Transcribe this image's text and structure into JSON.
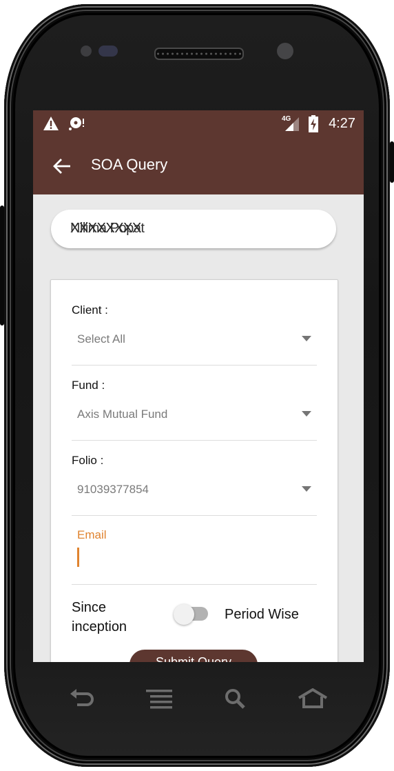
{
  "status_bar": {
    "time": "4:27",
    "network": "4G",
    "left_icons": [
      "warning-icon",
      "sd-card-alert-icon"
    ],
    "right_icons": [
      "signal-icon",
      "battery-charging-icon"
    ]
  },
  "app_bar": {
    "title": "SOA Query",
    "back_icon": "arrow-back-icon"
  },
  "name_field": {
    "value_overlay_a": "XXXXXXXX",
    "value_overlay_b": "Nilima Popat"
  },
  "form": {
    "client": {
      "label": "Client :",
      "selected": "Select All"
    },
    "fund": {
      "label": "Fund :",
      "selected": "Axis Mutual Fund"
    },
    "folio": {
      "label": "Folio :",
      "selected": "91039377854"
    },
    "email": {
      "label": "Email",
      "value": ""
    },
    "period_toggle": {
      "left_label_line1": "Since",
      "left_label_line2": "inception",
      "right_label": "Period Wise",
      "checked": false
    },
    "submit_label": "Submit Query"
  },
  "colors": {
    "primary": "#5d3730",
    "accent": "#e0832f"
  },
  "device_nav": {
    "buttons": [
      "back",
      "menu",
      "search",
      "home"
    ]
  }
}
